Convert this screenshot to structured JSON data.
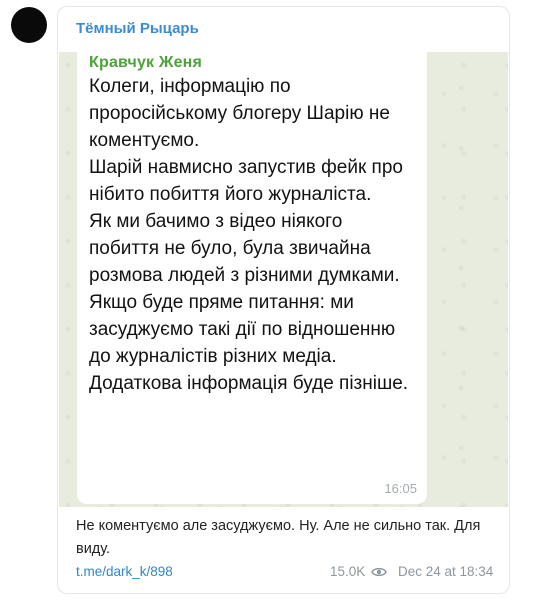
{
  "channel": {
    "title": "Тёмный Рыцарь"
  },
  "message": {
    "forwarded_sender": "Кравчук Женя",
    "paragraphs": [
      "Колеги, інформацію по проросійському блогеру Шарію не коментуємо.",
      "Шарій навмисно запустив фейк про нібито побиття його журналіста.",
      "Як ми бачимо з відео ніякого побиття не було, була звичайна розмова людей з різними думками.",
      "Якщо буде пряме питання: ми засуджуємо такі дії по відношенню до журналістів різних медіа.",
      "Додаткова інформація буде пізніше."
    ],
    "time": "16:05"
  },
  "post": {
    "caption": "Не коментуємо але засуджуємо. Ну. Але не сильно так. Для виду.",
    "link": "t.me/dark_k/898",
    "views": "15.0K",
    "date": "Dec 24 at 18:34"
  },
  "colors": {
    "channel_name": "#3e8bd5",
    "sender_name": "#4da33b",
    "link": "#2f87c8",
    "meta": "#8e979e"
  },
  "icons": {
    "views": "eye-icon"
  }
}
